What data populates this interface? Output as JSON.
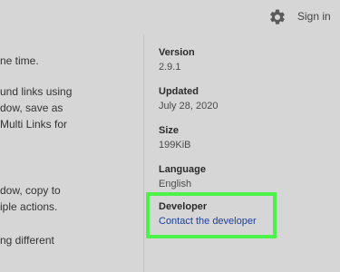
{
  "header": {
    "settings_icon": "gear-icon",
    "signin_label": "Sign in"
  },
  "description_lines": [
    "ne time.",
    "",
    "und links using",
    "dow, save as",
    "Multi Links for",
    "",
    "",
    "",
    "dow, copy to",
    "iple actions.",
    "",
    "ng different"
  ],
  "info": {
    "version": {
      "label": "Version",
      "value": "2.9.1"
    },
    "updated": {
      "label": "Updated",
      "value": "July 28, 2020"
    },
    "size": {
      "label": "Size",
      "value": "199KiB"
    },
    "language": {
      "label": "Language",
      "value": "English"
    },
    "developer": {
      "label": "Developer",
      "link": "Contact the developer"
    }
  },
  "colors": {
    "background": "#d6d6d6",
    "highlight_border": "#4cf24a",
    "link": "#1a3fa6"
  }
}
